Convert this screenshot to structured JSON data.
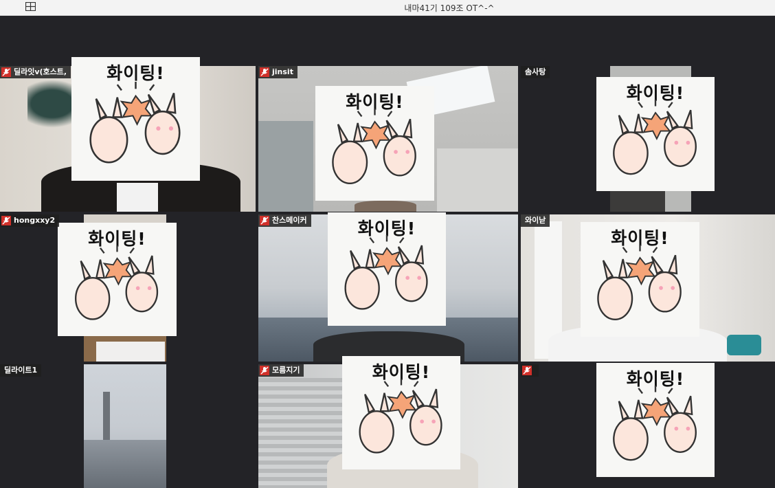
{
  "window": {
    "meeting_title": "내마41기 109조 OT^-^"
  },
  "sticker_text": "화이팅!",
  "participants": [
    {
      "name": "딜라잇v(호스트,"
    },
    {
      "name": "jinsit"
    },
    {
      "name": "솜사탕"
    },
    {
      "name": "hongxxy2"
    },
    {
      "name": "찬스메이커"
    },
    {
      "name": "와이낟"
    },
    {
      "name": "딜라이트1"
    },
    {
      "name": "모름지기"
    },
    {
      "name": ""
    }
  ],
  "colors": {
    "muted_mic": "#d0302a",
    "background": "#232327"
  },
  "icons": {
    "gallery_view": "grid-icon",
    "mic_status": "mic-muted-icon"
  }
}
